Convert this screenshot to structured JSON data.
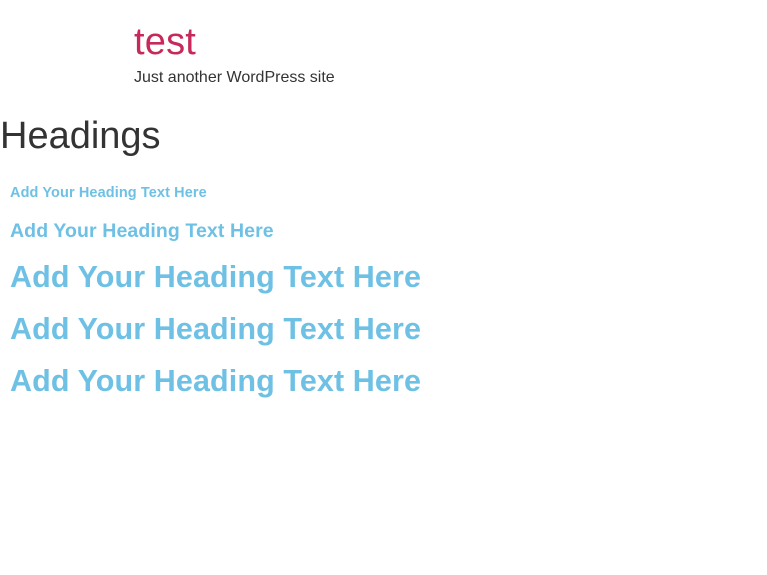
{
  "site": {
    "title": "test",
    "tagline": "Just another WordPress site"
  },
  "page": {
    "title": "Headings"
  },
  "headings": [
    "Add Your Heading Text Here",
    "Add Your Heading Text Here",
    "Add Your Heading Text Here",
    "Add Your Heading Text Here",
    "Add Your Heading Text Here"
  ],
  "colors": {
    "site_title": "#c7295b",
    "text": "#333333",
    "heading_accent": "#6ec1e4",
    "background": "#ffffff"
  }
}
